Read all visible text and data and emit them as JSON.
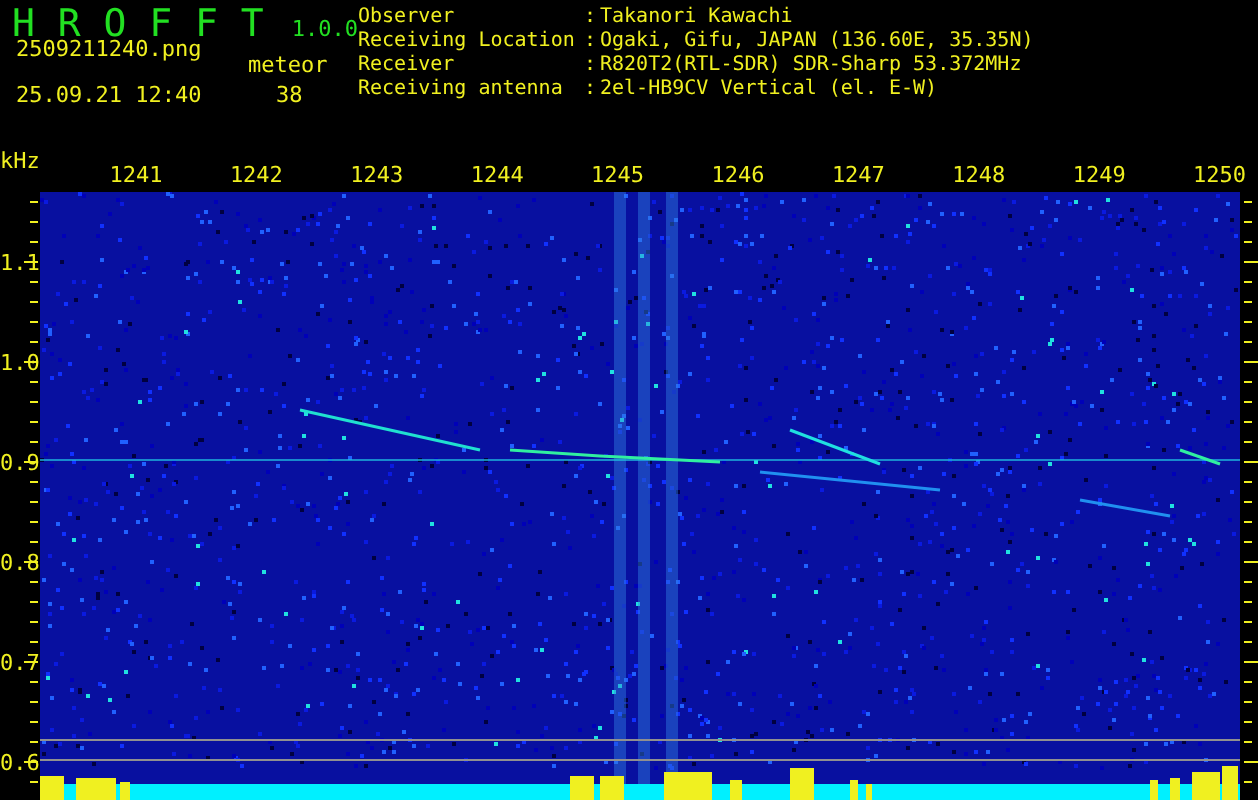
{
  "app": {
    "title": "H R O F F T",
    "version": "1.0.0"
  },
  "file": "2509211240.png",
  "timestamp": "25.09.21 12:40",
  "meteor": {
    "label": "meteor",
    "count": "38"
  },
  "info": [
    {
      "label": "Observer",
      "separator": ":",
      "value": "Takanori Kawachi"
    },
    {
      "label": "Receiving Location",
      "separator": ":",
      "value": "Ogaki, Gifu, JAPAN (136.60E, 35.35N)"
    },
    {
      "label": "Receiver",
      "separator": ":",
      "value": "R820T2(RTL-SDR) SDR-Sharp 53.372MHz"
    },
    {
      "label": "Receiving antenna",
      "separator": ":",
      "value": "2el-HB9CV Vertical (el. E-W)"
    }
  ],
  "spectrogram": {
    "y_unit": "kHz",
    "y_labels": [
      "1.1",
      "1.0",
      "0.9",
      "0.8",
      "0.7",
      "0.6"
    ],
    "x_labels": [
      "1241",
      "1242",
      "1243",
      "1244",
      "1245",
      "1246",
      "1247",
      "1248",
      "1249",
      "1250"
    ]
  }
}
